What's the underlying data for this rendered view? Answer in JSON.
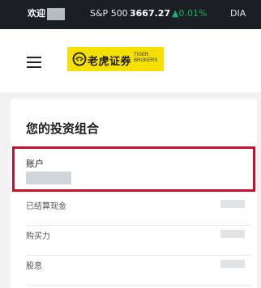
{
  "ticker": {
    "welcome": "欢迎",
    "items": [
      {
        "symbol": "S&P 500",
        "price": "3667.27",
        "change": "▲0.01%"
      },
      {
        "symbol": "DIA"
      }
    ]
  },
  "header": {
    "logo_cn": "老虎证券",
    "logo_en_line1": "TIGER",
    "logo_en_line2": "BROKERS"
  },
  "portfolio": {
    "title": "您的投资组合",
    "account_label": "账户",
    "rows": [
      {
        "label": "已结算现金"
      },
      {
        "label": "购买力"
      },
      {
        "label": "股息"
      }
    ]
  },
  "colors": {
    "ticker_bg": "#1b1f24",
    "up_green": "#17b26a",
    "brand_yellow": "#f6e000",
    "highlight_red": "#c8102e"
  }
}
